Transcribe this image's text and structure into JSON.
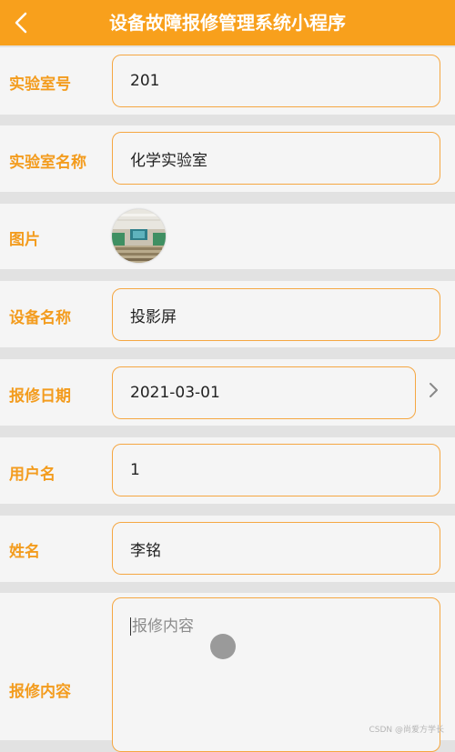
{
  "header": {
    "back_icon": "chevron-left-icon",
    "title": "设备故障报修管理系统小程序",
    "bg_color": "#f8a01c"
  },
  "form": {
    "lab_no": {
      "label": "实验室号",
      "value": "201"
    },
    "lab_name": {
      "label": "实验室名称",
      "value": "化学实验室"
    },
    "image": {
      "label": "图片"
    },
    "device_name": {
      "label": "设备名称",
      "value": "投影屏"
    },
    "repair_date": {
      "label": "报修日期",
      "value": "2021-03-01",
      "arrow_icon": "chevron-right-icon"
    },
    "username": {
      "label": "用户名",
      "value": "1"
    },
    "name": {
      "label": "姓名",
      "value": "李铭"
    },
    "repair_content": {
      "label": "报修内容",
      "placeholder": "报修内容"
    }
  },
  "watermark": "CSDN @尚爱方学长",
  "colors": {
    "accent": "#f8a01c",
    "label": "#f39c1e",
    "border": "#f5a742"
  }
}
